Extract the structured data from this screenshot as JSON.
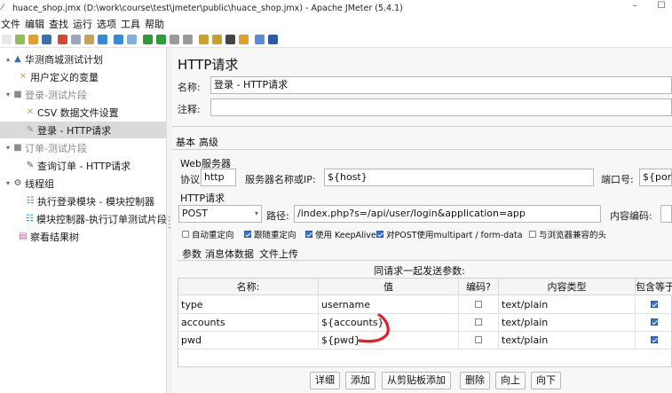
{
  "window": {
    "title": "huace_shop.jmx (D:\\work\\course\\test\\jmeter\\public\\huace_shop.jmx) - Apache JMeter (5.4.1)",
    "min_glyph": "–",
    "max_glyph": "☐"
  },
  "menu": [
    "文件",
    "编辑",
    "查找",
    "运行",
    "选项",
    "工具",
    "帮助"
  ],
  "toolbar": {
    "icons": [
      "new-icon",
      "template-icon",
      "open-icon",
      "save-icon",
      "cut-icon",
      "copy-icon",
      "paste-icon",
      "expand-icon",
      "collapse-icon",
      "toggle-icon",
      "start-icon",
      "start-no-pause-icon",
      "stop-icon",
      "shutdown-icon",
      "clear-icon",
      "clear-all-icon",
      "search-icon",
      "reset-search-icon",
      "function-helper-icon",
      "help-icon"
    ],
    "colors": [
      "#e8e8e8",
      "#8fbf5a",
      "#e0a030",
      "#3a6fb0",
      "#d04a3a",
      "#9aa7b8",
      "#c9a25a",
      "#3a8ad0",
      "#3a8ad0",
      "#7fb0d8",
      "#2e9b3a",
      "#2e9b3a",
      "#9a9a9a",
      "#9a9a9a",
      "#c8a030",
      "#c8a030",
      "#444444",
      "#e0a030",
      "#5a8ad0",
      "#2a5aa8"
    ]
  },
  "tree": {
    "nodes": [
      {
        "label": "华测商城测试计划",
        "toggle": "▴",
        "icon": "▲",
        "icon_name": "test-plan-icon",
        "icon_color": "#3a6fb0"
      },
      {
        "label": "用户定义的变量",
        "toggle": "",
        "icon": "✕",
        "icon_name": "config-element-icon",
        "icon_color": "#c9a25a"
      },
      {
        "label": "登录-测试片段",
        "toggle": "▾",
        "icon": "■",
        "icon_name": "test-fragment-icon",
        "icon_color": "#8a8a8a"
      },
      {
        "label": "CSV 数据文件设置",
        "toggle": "",
        "icon": "✕",
        "icon_name": "csv-config-icon",
        "icon_color": "#c9a25a"
      },
      {
        "label": "登录 - HTTP请求",
        "toggle": "",
        "icon": "✎",
        "icon_name": "http-sampler-icon",
        "icon_color": "#8a8a8a"
      },
      {
        "label": "订单-测试片段",
        "toggle": "▾",
        "icon": "■",
        "icon_name": "test-fragment-icon",
        "icon_color": "#8a8a8a"
      },
      {
        "label": "查询订单 - HTTP请求",
        "toggle": "",
        "icon": "✎",
        "icon_name": "http-sampler-icon",
        "icon_color": "#555555"
      },
      {
        "label": "线程组",
        "toggle": "▾",
        "icon": "⚙",
        "icon_name": "thread-group-icon",
        "icon_color": "#555555"
      },
      {
        "label": "执行登录模块 - 模块控制器",
        "toggle": "",
        "icon": "☷",
        "icon_name": "module-controller-icon",
        "icon_color": "#3a8ad0"
      },
      {
        "label": "模块控制器-执行订单测试片段",
        "toggle": "",
        "icon": "☷",
        "icon_name": "module-controller-icon",
        "icon_color": "#3a8ad0"
      },
      {
        "label": "察看结果树",
        "toggle": "",
        "icon": "▤",
        "icon_name": "listener-icon",
        "icon_color": "#c05a9a"
      }
    ]
  },
  "panel": {
    "title": "HTTP请求",
    "name_label": "名称:",
    "name_value": "登录 - HTTP请求",
    "comment_label": "注释:",
    "comment_value": "",
    "tabs": [
      "基本",
      "高级"
    ],
    "web_server": {
      "group_title": "Web服务器",
      "protocol_label": "协议:",
      "protocol_value": "http",
      "server_label": "服务器名称或IP:",
      "server_value": "${host}",
      "port_label": "端口号:",
      "port_value": "${port}"
    },
    "http_request": {
      "group_title": "HTTP请求",
      "method": "POST",
      "path_label": "路径:",
      "path_value": "/index.php?s=/api/user/login&application=app",
      "encoding_label": "内容编码:",
      "encoding_value": ""
    },
    "options": [
      {
        "label": "自动重定向",
        "checked": false
      },
      {
        "label": "跟随重定向",
        "checked": true
      },
      {
        "label": "使用 KeepAlive",
        "checked": true
      },
      {
        "label": "对POST使用multipart / form-data",
        "checked": true
      },
      {
        "label": "与浏览器兼容的头",
        "checked": false
      }
    ],
    "subtabs": [
      "参数",
      "消息体数据",
      "文件上传"
    ],
    "params_caption": "同请求一起发送参数:",
    "columns": [
      "名称:",
      "值",
      "编码?",
      "内容类型",
      "包含等于?"
    ],
    "rows": [
      {
        "name": "type",
        "value": "username",
        "encode": false,
        "content_type": "text/plain",
        "include_equals": true
      },
      {
        "name": "accounts",
        "value": "${accounts}",
        "encode": false,
        "content_type": "text/plain",
        "include_equals": true
      },
      {
        "name": "pwd",
        "value": "${pwd}",
        "encode": false,
        "content_type": "text/plain",
        "include_equals": true
      }
    ],
    "buttons": [
      "详细",
      "添加",
      "从剪贴板添加",
      "删除",
      "向上",
      "向下"
    ]
  },
  "annotation_color": "#e0202a"
}
